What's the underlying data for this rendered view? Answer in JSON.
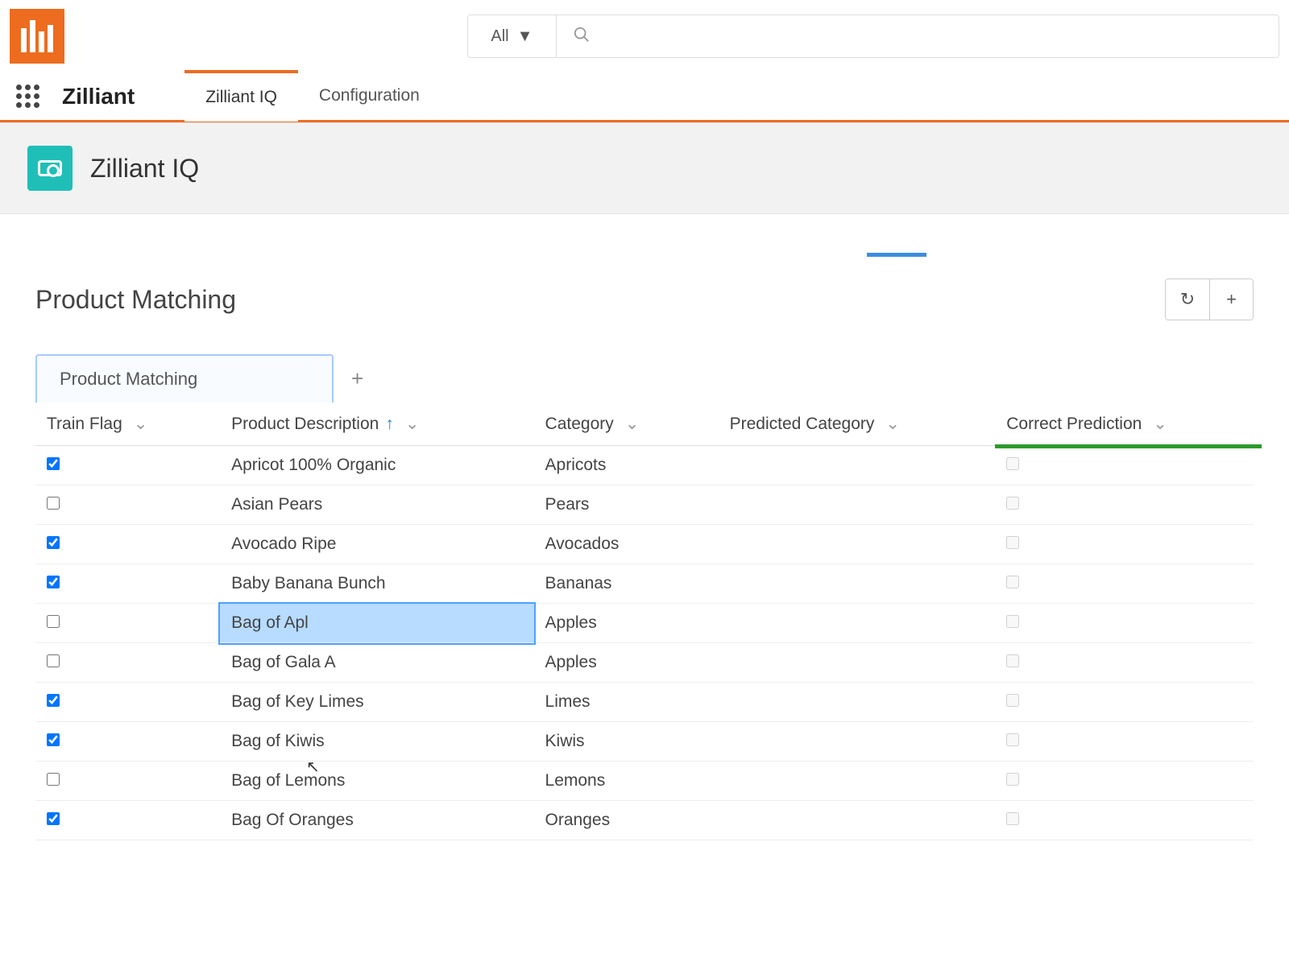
{
  "header": {
    "dropdown_label": "All"
  },
  "nav": {
    "brand": "Zilliant",
    "tabs": [
      {
        "label": "Zilliant IQ",
        "active": true
      },
      {
        "label": "Configuration",
        "active": false
      }
    ]
  },
  "title_bar": {
    "title": "Zilliant IQ"
  },
  "section": {
    "title": "Product Matching",
    "subtab_label": "Product Matching"
  },
  "table": {
    "columns": [
      {
        "key": "train_flag",
        "label": "Train Flag"
      },
      {
        "key": "description",
        "label": "Product Description",
        "sorted": "asc"
      },
      {
        "key": "category",
        "label": "Category"
      },
      {
        "key": "predicted",
        "label": "Predicted Category"
      },
      {
        "key": "correct",
        "label": "Correct Prediction"
      }
    ],
    "rows": [
      {
        "train_flag": true,
        "description": "Apricot 100% Organic",
        "category": "Apricots",
        "predicted": "",
        "correct": false,
        "selected": false
      },
      {
        "train_flag": false,
        "description": "Asian Pears",
        "category": "Pears",
        "predicted": "",
        "correct": false,
        "selected": false
      },
      {
        "train_flag": true,
        "description": "Avocado Ripe",
        "category": "Avocados",
        "predicted": "",
        "correct": false,
        "selected": false
      },
      {
        "train_flag": true,
        "description": "Baby Banana Bunch",
        "category": "Bananas",
        "predicted": "",
        "correct": false,
        "selected": false
      },
      {
        "train_flag": false,
        "description": "Bag of Apl",
        "category": "Apples",
        "predicted": "",
        "correct": false,
        "selected": true
      },
      {
        "train_flag": false,
        "description": "Bag of Gala A",
        "category": "Apples",
        "predicted": "",
        "correct": false,
        "selected": false
      },
      {
        "train_flag": true,
        "description": "Bag of Key Limes",
        "category": "Limes",
        "predicted": "",
        "correct": false,
        "selected": false
      },
      {
        "train_flag": true,
        "description": "Bag of Kiwis",
        "category": "Kiwis",
        "predicted": "",
        "correct": false,
        "selected": false
      },
      {
        "train_flag": false,
        "description": "Bag of Lemons",
        "category": "Lemons",
        "predicted": "",
        "correct": false,
        "selected": false
      },
      {
        "train_flag": true,
        "description": "Bag Of Oranges",
        "category": "Oranges",
        "predicted": "",
        "correct": false,
        "selected": false
      }
    ]
  }
}
